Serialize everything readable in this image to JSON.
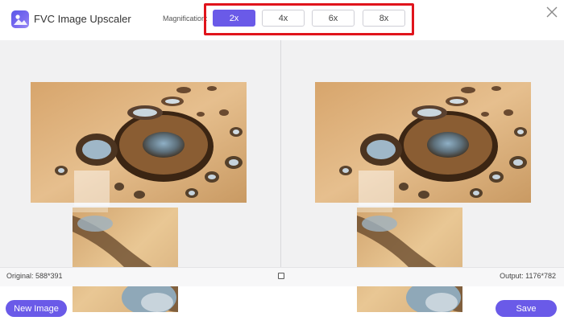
{
  "app": {
    "title": "FVC Image Upscaler",
    "logo_icon": "image-upscaler-logo-icon"
  },
  "magnification": {
    "label": "Magnification:",
    "options": [
      "2x",
      "4x",
      "6x",
      "8x"
    ],
    "selected": "2x"
  },
  "window": {
    "close_icon": "close-icon"
  },
  "panels": {
    "original_label": "Original: 588*391",
    "output_label": "Output: 1176*782",
    "compare_icon": "compare-toggle-icon"
  },
  "actions": {
    "new_image": "New Image",
    "save": "Save"
  },
  "colors": {
    "accent": "#6a5ae8",
    "highlight": "#e0141c",
    "workspace": "#f1f1f2"
  }
}
